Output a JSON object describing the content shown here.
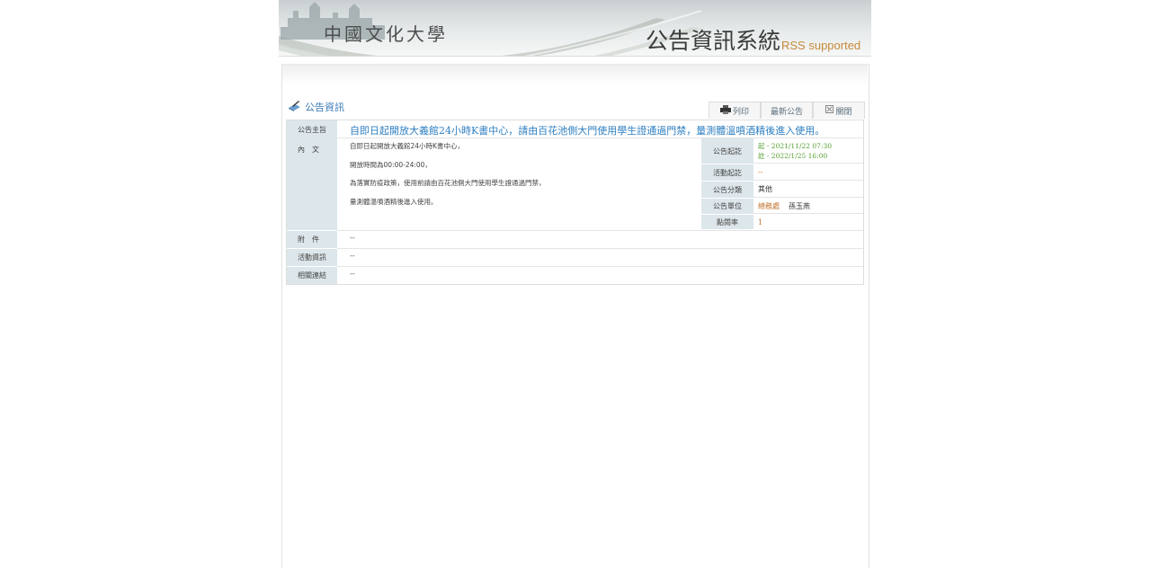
{
  "banner": {
    "school_name": "中國文化大學",
    "system_title": "公告資訊系統",
    "rss": "RSS supported"
  },
  "section": {
    "title": "公告資訊"
  },
  "toolbar": {
    "print": "列印",
    "latest": "最新公告",
    "close": "關閉"
  },
  "labels": {
    "subject": "公告主旨",
    "content": "內文",
    "attachment": "附件",
    "activity_info": "活動資訊",
    "related_links": "相關連結"
  },
  "announcement": {
    "subject": "自即日起開放大義館24小時K書中心，請由百花池側大門使用學生證通過門禁，量測體溫噴酒精後進入使用。",
    "paragraphs": [
      "自即日起開放大義館24小時K書中心，",
      "開放時間為00:00-24:00，",
      "為落實防疫政策，使用前請由百花池側大門使用學生證通過門禁，",
      "量測體溫噴酒精後進入使用。"
    ],
    "attachment": "--",
    "activity_info": "--",
    "related_links": "--"
  },
  "meta": {
    "period_label": "公告起訖",
    "period_start": "起 - 2021/11/22 07:30",
    "period_end": "訖 - 2022/1/25 16:00",
    "activity_period_label": "活動起訖",
    "activity_period": "--",
    "category_label": "公告分類",
    "category": "其他",
    "unit_label": "公告單位",
    "unit": "總務處",
    "contact": "孫玉燕",
    "clicks_label": "點閱率",
    "clicks": "1"
  },
  "colors": {
    "label_bg": "#dde6ea",
    "headline": "#2f7fc0",
    "accent_green": "#55a030",
    "accent_orange": "#c0702a"
  },
  "icons": {
    "section": "book-pencil-icon",
    "print": "printer-icon",
    "close": "close-box-icon"
  }
}
